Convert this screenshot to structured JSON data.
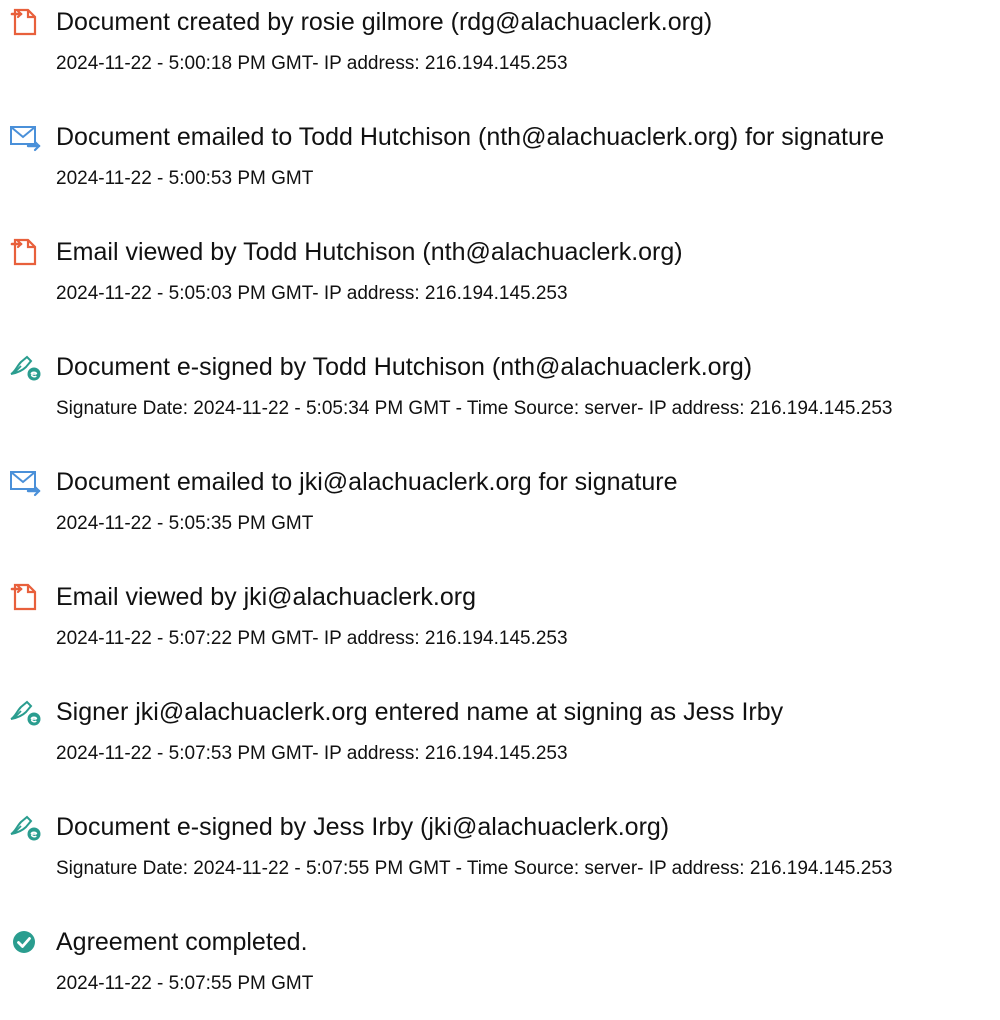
{
  "entries": [
    {
      "icon": "document-created-icon",
      "title": "Document created by rosie gilmore (rdg@alachuaclerk.org)",
      "detail": "2024-11-22 - 5:00:18 PM GMT- IP address: 216.194.145.253"
    },
    {
      "icon": "email-sent-icon",
      "title": "Document emailed to Todd Hutchison (nth@alachuaclerk.org) for signature",
      "detail": "2024-11-22 - 5:00:53 PM GMT"
    },
    {
      "icon": "email-viewed-icon",
      "title": "Email viewed by Todd Hutchison (nth@alachuaclerk.org)",
      "detail": "2024-11-22 - 5:05:03 PM GMT- IP address: 216.194.145.253"
    },
    {
      "icon": "esign-pen-icon",
      "title": "Document e-signed by Todd Hutchison (nth@alachuaclerk.org)",
      "detail": "Signature Date: 2024-11-22 - 5:05:34 PM GMT - Time Source: server- IP address: 216.194.145.253"
    },
    {
      "icon": "email-sent-icon",
      "title": "Document emailed to jki@alachuaclerk.org for signature",
      "detail": "2024-11-22 - 5:05:35 PM GMT"
    },
    {
      "icon": "email-viewed-icon",
      "title": "Email viewed by jki@alachuaclerk.org",
      "detail": "2024-11-22 - 5:07:22 PM GMT- IP address: 216.194.145.253"
    },
    {
      "icon": "esign-pen-icon",
      "title": "Signer jki@alachuaclerk.org entered name at signing as Jess Irby",
      "detail": "2024-11-22 - 5:07:53 PM GMT- IP address: 216.194.145.253"
    },
    {
      "icon": "esign-pen-icon",
      "title": "Document e-signed by Jess Irby (jki@alachuaclerk.org)",
      "detail": "Signature Date: 2024-11-22 - 5:07:55 PM GMT - Time Source: server- IP address: 216.194.145.253"
    },
    {
      "icon": "check-circle-icon",
      "title": "Agreement completed.",
      "detail": "2024-11-22 - 5:07:55 PM GMT"
    }
  ],
  "colors": {
    "doc_icon": "#e8603c",
    "mail_icon": "#4a90d9",
    "sign_icon": "#2a9d8f",
    "check_icon": "#2a9d8f"
  }
}
